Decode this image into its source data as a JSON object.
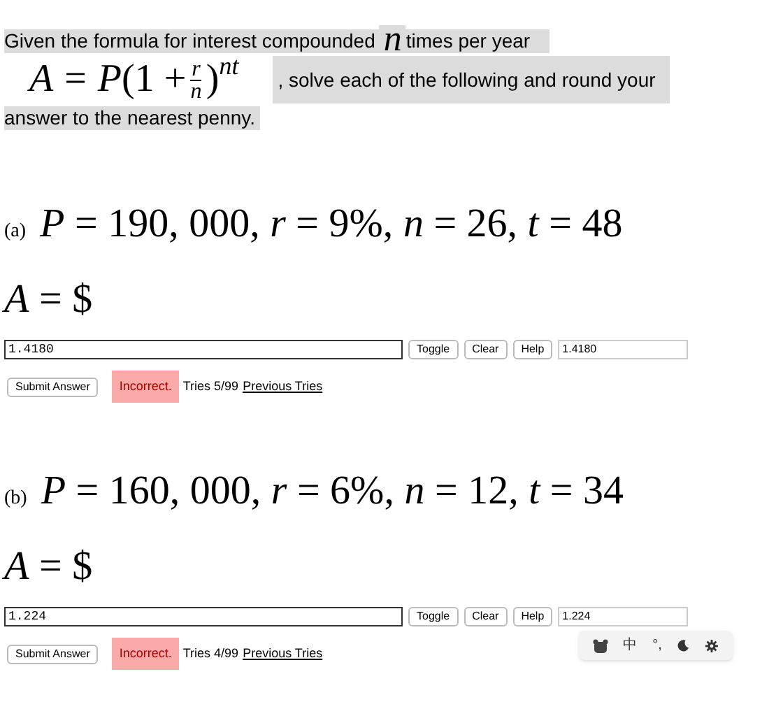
{
  "intro": {
    "before": "Given the formula for interest compounded",
    "var": "n",
    "after": "times per year",
    "formula": {
      "lhs": "A",
      "eq": "=",
      "body": "P(1 +",
      "num": "r",
      "den": "n",
      "close": ")",
      "exp": "nt"
    },
    "rest": ", solve each of the following and round your",
    "last": "answer to the nearest penny."
  },
  "problems": [
    {
      "label": "(a)",
      "given": "*P* = 190, 000, *r* = 9%, *n* = 26, *t* = 48",
      "answer_label": "*A* = $",
      "value": "1.4180",
      "preview": "1.4180",
      "buttons": [
        "Toggle",
        "Clear",
        "Help"
      ],
      "submit": "Submit Answer",
      "result": "Incorrect.",
      "tries": "Tries 5/99",
      "previous": "Previous Tries"
    },
    {
      "label": "(b)",
      "given": "*P* = 160, 000, *r* = 6%, *n* = 12, *t* = 34",
      "answer_label": "*A* = $",
      "value": "1.224",
      "preview": "1.224",
      "buttons": [
        "Toggle",
        "Clear",
        "Help"
      ],
      "submit": "Submit Answer",
      "result": "Incorrect.",
      "tries": "Tries 4/99",
      "previous": "Previous Tries"
    }
  ],
  "ime_toolbar": {
    "items": [
      {
        "kind": "icon"
      },
      {
        "kind": "text",
        "text": "中"
      },
      {
        "kind": "text",
        "text": "°,"
      },
      {
        "kind": "moon"
      },
      {
        "kind": "gear"
      }
    ]
  }
}
